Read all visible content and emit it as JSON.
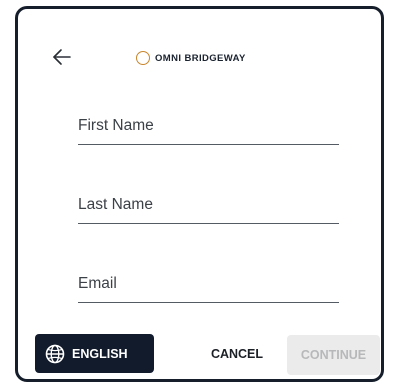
{
  "header": {
    "back_icon": "arrow-left-icon",
    "logo_icon": "ring-logo-icon",
    "logo_text": "OMNI BRIDGEWAY"
  },
  "form": {
    "fields": [
      {
        "label": "First Name",
        "value": ""
      },
      {
        "label": "Last Name",
        "value": ""
      },
      {
        "label": "Email",
        "value": ""
      }
    ]
  },
  "footer": {
    "language_icon": "globe-icon",
    "language_label": "ENGLISH",
    "cancel_label": "CANCEL",
    "continue_label": "CONTINUE",
    "continue_disabled": true
  },
  "colors": {
    "frame_border": "#161e2b",
    "language_button_bg": "#111b2c",
    "logo_accent": "#c8862d",
    "disabled_button_bg": "#ebebeb",
    "disabled_text": "#b7b8ba"
  }
}
